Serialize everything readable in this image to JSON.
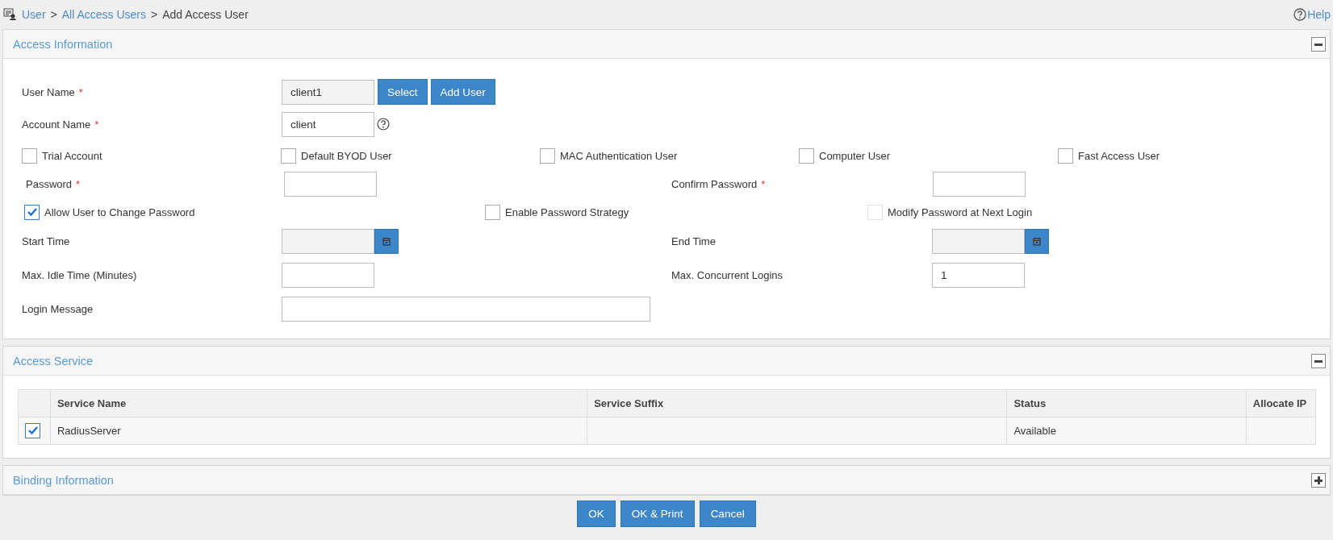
{
  "breadcrumb": [
    {
      "text": "User",
      "link": true
    },
    {
      "text": ">",
      "link": false
    },
    {
      "text": "All Access Users",
      "link": true
    },
    {
      "text": ">",
      "link": false
    },
    {
      "text": "Add Access User",
      "link": false
    }
  ],
  "help": "Help",
  "access_information": {
    "title": "Access Information",
    "expanded": true,
    "user_name": {
      "label": "User Name",
      "required_mark": "*",
      "value": "client1",
      "disabled": true,
      "buttons": [
        "Select",
        "Add User"
      ]
    },
    "account_name": {
      "label": "Account Name",
      "required_mark": "*",
      "value": "client"
    },
    "account_types": [
      {
        "label": "Trial Account",
        "checked": false
      },
      {
        "label": "Default BYOD User",
        "checked": false
      },
      {
        "label": "MAC Authentication User",
        "checked": false
      },
      {
        "label": "Computer User",
        "checked": false
      },
      {
        "label": "Fast Access User",
        "checked": false
      }
    ],
    "password": {
      "label": "Password",
      "required_mark": "*"
    },
    "confirm_password": {
      "label": "Confirm Password",
      "required_mark": "*"
    },
    "password_options": [
      {
        "label": "Allow User to Change Password",
        "checked": true,
        "disabled": false
      },
      {
        "label": "Enable Password Strategy",
        "checked": false,
        "disabled": false
      },
      {
        "label": "Modify Password at Next Login",
        "checked": false,
        "disabled": true
      }
    ],
    "start_time": {
      "label": "Start Time",
      "disabled": true
    },
    "end_time": {
      "label": "End Time",
      "disabled": true
    },
    "max_idle_time": {
      "label": "Max. Idle Time (Minutes)"
    },
    "max_concurrent_logins": {
      "label": "Max. Concurrent Logins",
      "value": "1"
    },
    "login_message": {
      "label": "Login Message"
    }
  },
  "access_service": {
    "title": "Access Service",
    "expanded": true,
    "columns": [
      "Service Name",
      "Service Suffix",
      "Status",
      "Allocate IP"
    ],
    "rows": [
      {
        "checked": true,
        "cells": [
          "RadiusServer",
          "",
          "Available",
          ""
        ]
      }
    ]
  },
  "binding_information": {
    "title": "Binding Information",
    "expanded": false
  },
  "buttons": [
    "OK",
    "OK & Print",
    "Cancel"
  ]
}
